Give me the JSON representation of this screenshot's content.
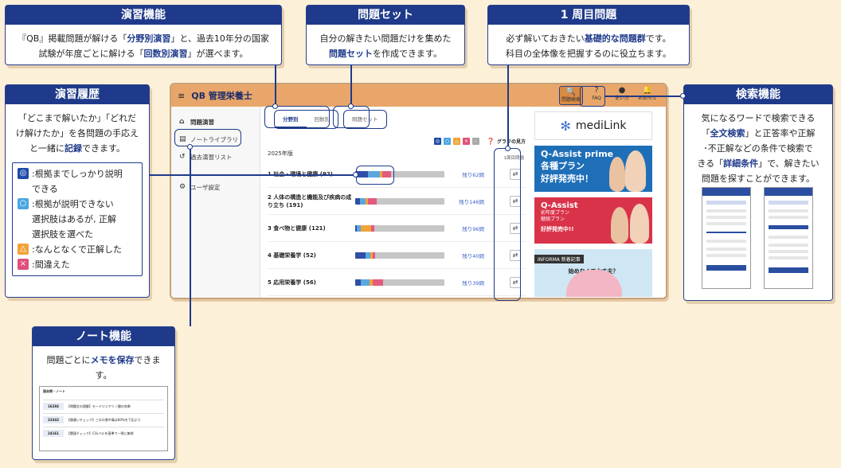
{
  "callouts": {
    "practice": {
      "title": "演習機能",
      "line1_a": "『QB』掲載問題が解ける「",
      "line1_b": "分野別演習",
      "line1_c": "」と、過去10年分の国家",
      "line2_a": "試験が年度ごとに解ける「",
      "line2_b": "回数別演習",
      "line2_c": "」が選べます。"
    },
    "qset": {
      "title": "問題セット",
      "line1": "自分の解きたい問題だけを集めた",
      "line2_b": "問題セット",
      "line2_c": "を作成できます。"
    },
    "first": {
      "title": "1 周目問題",
      "line1_a": "必ず解いておきたい",
      "line1_b": "基礎的な問題群",
      "line1_c": "です。",
      "line2": "科目の全体像を把握するのに役立ちます。"
    },
    "history": {
      "title": "演習履歴",
      "line1": "「どこまで解いたか」「どれだ",
      "line2": "け解けたか」を各問題の手応え",
      "line3_a": "と一緒に",
      "line3_b": "記録",
      "line3_c": "できます。",
      "legend": [
        {
          "mark": "◎",
          "color": "#1f4aa8",
          "text1": ":根拠までしっかり説明",
          "text2": "できる"
        },
        {
          "mark": "○",
          "color": "#4aa6e0",
          "text1": ":根拠が説明できない",
          "text2": "選択肢はあるが, 正解",
          "text3": "選択肢を選べた"
        },
        {
          "mark": "△",
          "color": "#f2a33a",
          "text1": ":なんとなくで正解した"
        },
        {
          "mark": "×",
          "color": "#e0507a",
          "text1": ":間違えた"
        }
      ]
    },
    "search": {
      "title": "検索機能",
      "line1": "気になるワードで検索できる",
      "line2_a": "「",
      "line2_b": "全文検索",
      "line2_c": "」と正答率や正解",
      "line3": "･不正解などの条件で検索で",
      "line4_a": "きる「",
      "line4_b": "詳細条件",
      "line4_c": "」で、解きたい",
      "line5": "問題を探すことができます。"
    },
    "note": {
      "title": "ノート機能",
      "line1_a": "問題ごとに",
      "line1_b": "メモを保存",
      "line1_c": "できます。"
    }
  },
  "app": {
    "logo": "QB 管理栄養士",
    "header_buttons": [
      {
        "icon": "🔍",
        "label": "問題検索"
      },
      {
        "icon": "?",
        "label": "FAQ"
      },
      {
        "icon": "●",
        "label": "使い方"
      },
      {
        "icon": "🔔",
        "label": "お知らせ"
      }
    ],
    "sidebar": [
      {
        "icon": "⌂",
        "label": "問題演習"
      },
      {
        "icon": "▤",
        "label": "ノートライブラリ"
      },
      {
        "icon": "↺",
        "label": "過去演習リスト"
      },
      {
        "icon": "⚙",
        "label": "ユーザ設定"
      }
    ],
    "tabs": {
      "field": "分野別",
      "round": "回数別",
      "set": "問題セット"
    },
    "toolbar": {
      "graph": "グラフの見方",
      "first_col": "1周目問題"
    },
    "year": "2025年版",
    "subjects": [
      {
        "name": "1 社会・環境と健康 (92)",
        "remain": "残り62問",
        "progress": [
          0.14,
          0.14,
          0.02,
          0.1
        ]
      },
      {
        "name": "2 人体の構造と機能及び疾病の成り立ち (191)",
        "remain": "残り146問",
        "progress": [
          0.05,
          0.07,
          0.02,
          0.1
        ]
      },
      {
        "name": "3 食べ物と健康 (121)",
        "remain": "残り96問",
        "progress": [
          0.02,
          0.04,
          0.12,
          0.03
        ]
      },
      {
        "name": "4 基礎栄養学 (52)",
        "remain": "残り40問",
        "progress": [
          0.12,
          0.05,
          0.03,
          0.02
        ]
      },
      {
        "name": "5 応用栄養学 (56)",
        "remain": "残り39問",
        "progress": [
          0.06,
          0.1,
          0.04,
          0.11
        ]
      }
    ],
    "ads": {
      "medilink": "mediLink",
      "prime_1": "Q-Assist prime",
      "prime_2": "各種プラン",
      "prime_3": "好評発売中！",
      "qa_1": "Q-Assist",
      "qa_2": "初年度プラン",
      "qa_3": "継続プラン",
      "qa_4": "好評発売中!!",
      "inf_label": "INFORMA 新着記事",
      "inf_1": "始めなくて大丈夫？"
    }
  },
  "note_preview": {
    "title": "過去問・ノート",
    "rows": [
      {
        "id": "16284",
        "text": "【問題文の理解】モードツジアミノ酸の効果"
      },
      {
        "id": "23343",
        "text": "【間違いチェック】三半の食中毒は80%を下記より"
      },
      {
        "id": "24161",
        "text": "【関連チェック】CO₂ベルを基準で一律に無視"
      }
    ]
  },
  "colors": {
    "accent": "#1f3a8a",
    "header": "#e9a66a",
    "bar_blue": "#2e4fa6",
    "bar_light": "#5aa7e0",
    "bar_orange": "#f2a33a",
    "bar_pink": "#e25a7d"
  }
}
